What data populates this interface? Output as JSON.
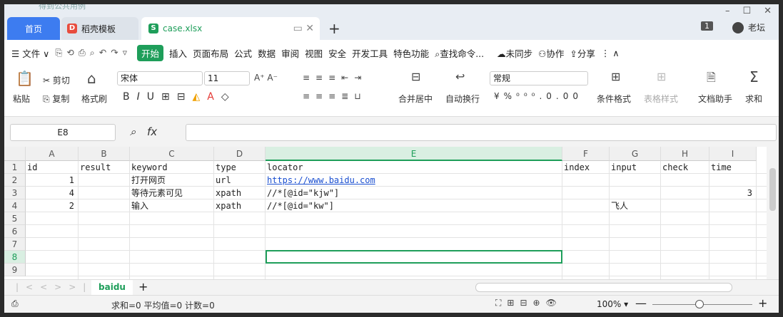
{
  "titlebar": {
    "bg_text": "得到公共用例",
    "tabs": [
      {
        "label": "首页"
      },
      {
        "label": "稻壳模板"
      },
      {
        "label": "case.xlsx"
      }
    ],
    "user": "老坛",
    "page_badge": "1"
  },
  "menu": {
    "file": "文件",
    "kaishi": "开始",
    "items": [
      "插入",
      "页面布局",
      "公式",
      "数据",
      "审阅",
      "视图",
      "安全",
      "开发工具",
      "特色功能"
    ],
    "search": "查找命令...",
    "sync": "未同步",
    "collab": "协作",
    "share": "分享"
  },
  "ribbon": {
    "paste": "粘贴",
    "cut": "剪切",
    "copy": "复制",
    "format_painter": "格式刷",
    "font": "宋体",
    "size": "11",
    "merge": "合并居中",
    "wrap": "自动换行",
    "numfmt": "常规",
    "cond": "条件格式",
    "table_style": "表格样式",
    "doc_helper": "文档助手",
    "sum": "求和"
  },
  "formula": {
    "namebox": "E8",
    "fx": "fx",
    "content": ""
  },
  "columns": [
    "A",
    "B",
    "C",
    "D",
    "E",
    "F",
    "G",
    "H",
    "I"
  ],
  "rows": [
    "1",
    "2",
    "3",
    "4",
    "5",
    "6",
    "7",
    "8",
    "9"
  ],
  "cells": {
    "A1": "id",
    "B1": "result",
    "C1": "keyword",
    "D1": "type",
    "E1": "locator",
    "F1": "index",
    "G1": "input",
    "H1": "check",
    "I1": "time",
    "A2": "1",
    "C2": "打开网页",
    "D2": "url",
    "E2": "https://www.baidu.com",
    "A3": "4",
    "C3": "等待元素可见",
    "D3": "xpath",
    "E3": "//*[@id=\"kjw\"]",
    "I3": "3",
    "A4": "2",
    "C4": "输入",
    "D4": "xpath",
    "E4": "//*[@id=\"kw\"]",
    "G4": "飞人"
  },
  "sheet": {
    "name": "baidu"
  },
  "status": {
    "summary": "求和=0  平均值=0  计数=0",
    "zoom": "100%"
  }
}
